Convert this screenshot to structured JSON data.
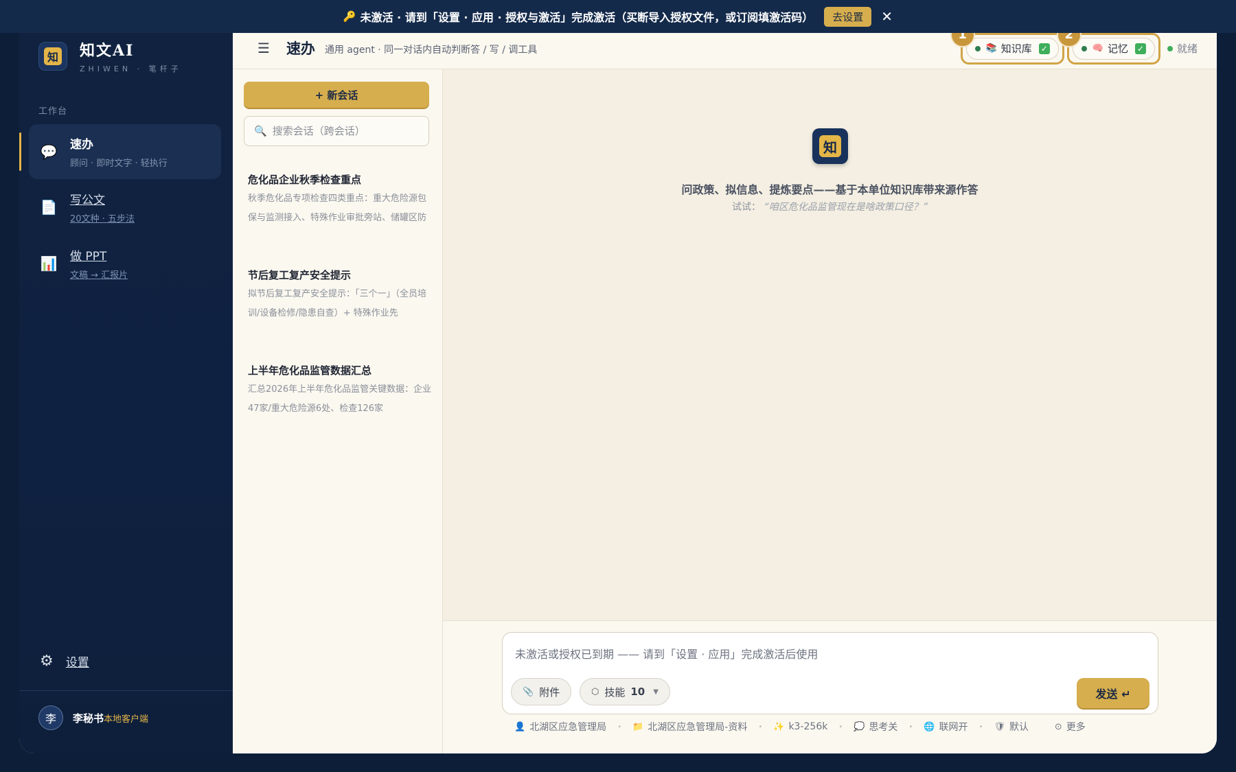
{
  "banner": {
    "key_icon": "key-icon",
    "message": "未激活 · 请到「设置 · 应用 · 授权与激活」完成激活（买断导入授权文件，或订阅填激活码）",
    "go_settings": "去设置",
    "close": "✕"
  },
  "sidebar": {
    "logo_glyph": "知",
    "brand_name": "知文AI",
    "brand_sub": "ZHIWEN · 笔杆子",
    "section_label": "工作台",
    "items": [
      {
        "title": "速办",
        "sub": "顾问 · 即时文字 · 轻执行",
        "icon": "speech-bubble-icon",
        "glyph": "💬"
      },
      {
        "title": "写公文",
        "sub": "20文种 · 五步法",
        "icon": "document-icon",
        "glyph": "📄"
      },
      {
        "title": "做 PPT",
        "sub": "文稿 → 汇报片",
        "icon": "bar-chart-icon",
        "glyph": "📊"
      }
    ],
    "settings_label": "设置",
    "user": {
      "avatar": "李",
      "name": "李秘书",
      "tag": "本地客户端"
    }
  },
  "topbar": {
    "title": "速办",
    "subtitle": "通用 agent · 同一对话内自动判断答 / 写 / 调工具",
    "chips": [
      {
        "badge": "1",
        "label": "知识库",
        "icon": "books-icon",
        "glyph": "📚",
        "checked": true
      },
      {
        "badge": "2",
        "label": "记忆",
        "icon": "brain-icon",
        "glyph": "🧠",
        "checked": true
      }
    ],
    "status": "就绪"
  },
  "conversations": {
    "new_button": "+ 新会话",
    "search_placeholder": "搜索会话（跨会话）",
    "items": [
      {
        "title": "危化品企业秋季检查重点",
        "snippet": "秋季危化品专项检查四类重点：重大危险源包保与监测接入、特殊作业审批旁站、储罐区防"
      },
      {
        "title": "节后复工复产安全提示",
        "snippet": "拟节后复工复产安全提示：「三个一」（全员培训/设备检修/隐患自查）+ 特殊作业先"
      },
      {
        "title": "上半年危化品监管数据汇总",
        "snippet": "汇总2026年上半年危化品监管关键数据：企业47家/重大危险源6处、检查126家"
      }
    ]
  },
  "chat": {
    "logo_glyph": "知",
    "headline": "问政策、拟信息、提炼要点——基于本单位知识库带来源作答",
    "try_label": "试试：",
    "try_example": "“咱区危化品监管现在是啥政策口径？”"
  },
  "composer": {
    "placeholder": "未激活或授权已到期 —— 请到「设置 · 应用」完成激活后使用",
    "attach": "附件",
    "skills_label": "技能",
    "skills_count": "10",
    "send": "发送 ↵"
  },
  "status_bar": [
    {
      "icon": "person-icon",
      "glyph": "👤",
      "label": "北湖区应急管理局"
    },
    {
      "icon": "folder-icon",
      "glyph": "📁",
      "label": "北湖区应急管理局-资料"
    },
    {
      "icon": "sparkle-icon",
      "glyph": "✨",
      "label": "k3-256k"
    },
    {
      "icon": "thought-icon",
      "glyph": "💭",
      "label": "思考关"
    },
    {
      "icon": "globe-icon",
      "glyph": "🌐",
      "label": "联网开"
    },
    {
      "icon": "shield-icon",
      "glyph": "🛡",
      "label": "默认"
    },
    {
      "icon": "more-icon",
      "glyph": "⊙",
      "label": "更多"
    }
  ],
  "colors": {
    "accent_gold": "#d6ae4e",
    "sidebar_navy": "#10223f",
    "status_green": "#3fae5a"
  }
}
